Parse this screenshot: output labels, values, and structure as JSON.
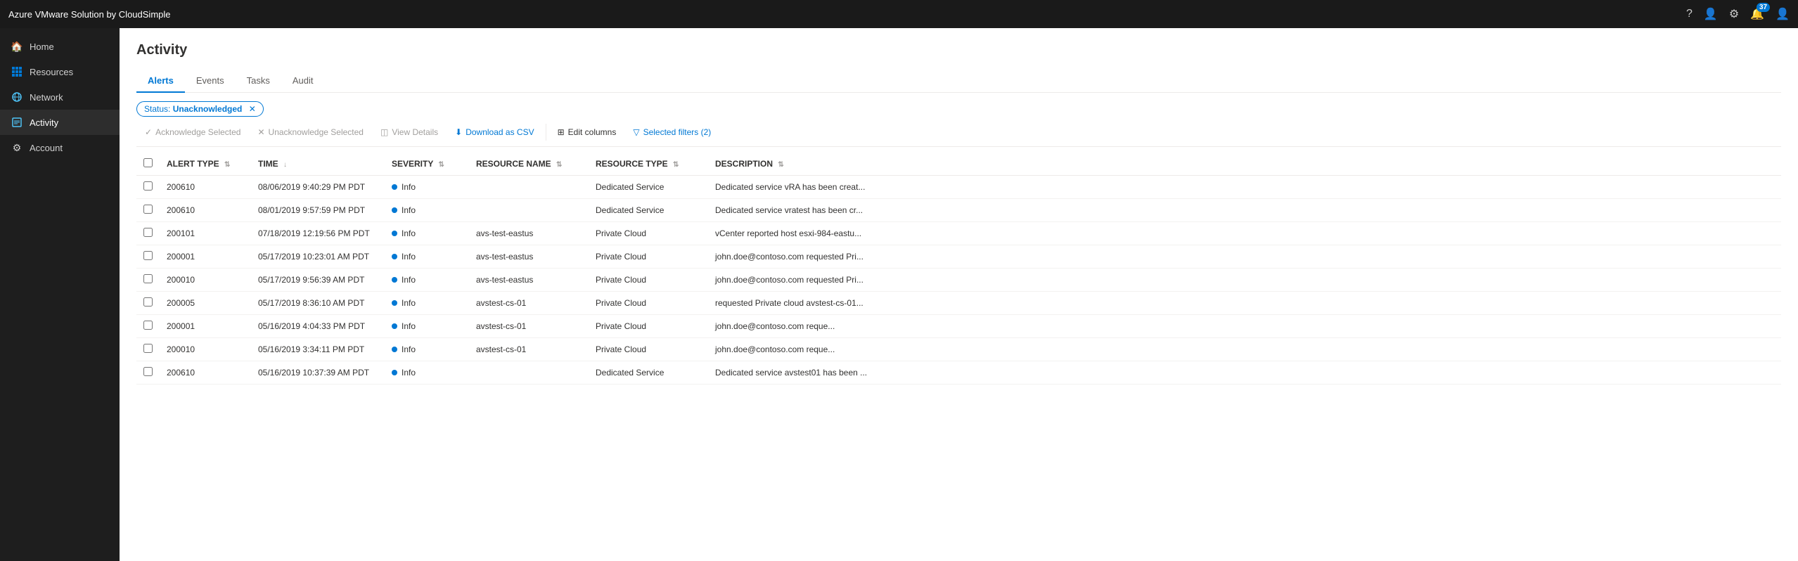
{
  "app": {
    "title": "Azure VMware Solution by CloudSimple"
  },
  "topbar": {
    "icons": [
      "help",
      "user-settings",
      "settings",
      "notifications",
      "account"
    ],
    "notification_count": "37"
  },
  "sidebar": {
    "items": [
      {
        "id": "home",
        "label": "Home",
        "icon": "🏠",
        "active": false
      },
      {
        "id": "resources",
        "label": "Resources",
        "icon": "⊞",
        "active": false
      },
      {
        "id": "network",
        "label": "Network",
        "icon": "🌐",
        "active": false
      },
      {
        "id": "activity",
        "label": "Activity",
        "icon": "📋",
        "active": true
      },
      {
        "id": "account",
        "label": "Account",
        "icon": "⚙",
        "active": false
      }
    ]
  },
  "page": {
    "title": "Activity"
  },
  "tabs": [
    {
      "id": "alerts",
      "label": "Alerts",
      "active": true
    },
    {
      "id": "events",
      "label": "Events",
      "active": false
    },
    {
      "id": "tasks",
      "label": "Tasks",
      "active": false
    },
    {
      "id": "audit",
      "label": "Audit",
      "active": false
    }
  ],
  "filter": {
    "status_label": "Status:",
    "status_value": "Unacknowledged"
  },
  "toolbar": {
    "acknowledge_label": "Acknowledge Selected",
    "unacknowledge_label": "Unacknowledge Selected",
    "view_details_label": "View Details",
    "download_label": "Download as CSV",
    "edit_columns_label": "Edit columns",
    "selected_filters_label": "Selected filters (2)"
  },
  "table": {
    "columns": [
      {
        "id": "alert_type",
        "label": "ALERT TYPE"
      },
      {
        "id": "time",
        "label": "TIME"
      },
      {
        "id": "severity",
        "label": "SEVERITY"
      },
      {
        "id": "resource_name",
        "label": "RESOURCE NAME"
      },
      {
        "id": "resource_type",
        "label": "RESOURCE TYPE"
      },
      {
        "id": "description",
        "label": "DESCRIPTION"
      }
    ],
    "rows": [
      {
        "alert_type": "200610",
        "time": "08/06/2019 9:40:29 PM PDT",
        "severity": "Info",
        "resource_name": "",
        "resource_type": "Dedicated Service",
        "description": "Dedicated service vRA has been creat..."
      },
      {
        "alert_type": "200610",
        "time": "08/01/2019 9:57:59 PM PDT",
        "severity": "Info",
        "resource_name": "",
        "resource_type": "Dedicated Service",
        "description": "Dedicated service vratest has been cr..."
      },
      {
        "alert_type": "200101",
        "time": "07/18/2019 12:19:56 PM PDT",
        "severity": "Info",
        "resource_name": "avs-test-eastus",
        "resource_type": "Private Cloud",
        "description": "vCenter reported host esxi-984-eastu..."
      },
      {
        "alert_type": "200001",
        "time": "05/17/2019 10:23:01 AM PDT",
        "severity": "Info",
        "resource_name": "avs-test-eastus",
        "resource_type": "Private Cloud",
        "description": "john.doe@contoso.com  requested Pri..."
      },
      {
        "alert_type": "200010",
        "time": "05/17/2019 9:56:39 AM PDT",
        "severity": "Info",
        "resource_name": "avs-test-eastus",
        "resource_type": "Private Cloud",
        "description": "john.doe@contoso.com  requested Pri..."
      },
      {
        "alert_type": "200005",
        "time": "05/17/2019 8:36:10 AM PDT",
        "severity": "Info",
        "resource_name": "avstest-cs-01",
        "resource_type": "Private Cloud",
        "description": "requested Private cloud avstest-cs-01..."
      },
      {
        "alert_type": "200001",
        "time": "05/16/2019 4:04:33 PM PDT",
        "severity": "Info",
        "resource_name": "avstest-cs-01",
        "resource_type": "Private Cloud",
        "description": "john.doe@contoso.com    reque..."
      },
      {
        "alert_type": "200010",
        "time": "05/16/2019 3:34:11 PM PDT",
        "severity": "Info",
        "resource_name": "avstest-cs-01",
        "resource_type": "Private Cloud",
        "description": "john.doe@contoso.com    reque..."
      },
      {
        "alert_type": "200610",
        "time": "05/16/2019 10:37:39 AM PDT",
        "severity": "Info",
        "resource_name": "",
        "resource_type": "Dedicated Service",
        "description": "Dedicated service avstest01 has been ..."
      }
    ]
  }
}
